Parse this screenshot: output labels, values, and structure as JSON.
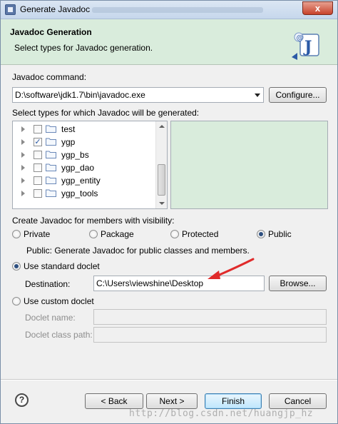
{
  "window": {
    "title": "Generate Javadoc",
    "close_label": "x"
  },
  "header": {
    "title": "Javadoc Generation",
    "description": "Select types for Javadoc generation."
  },
  "command": {
    "label": "Javadoc command:",
    "value": "D:\\software\\jdk1.7\\bin\\javadoc.exe",
    "configure_label": "Configure..."
  },
  "types": {
    "label": "Select types for which Javadoc will be generated:",
    "items": [
      {
        "label": "test",
        "checked": false
      },
      {
        "label": "ygp",
        "checked": true
      },
      {
        "label": "ygp_bs",
        "checked": false
      },
      {
        "label": "ygp_dao",
        "checked": false
      },
      {
        "label": "ygp_entity",
        "checked": false
      },
      {
        "label": "ygp_tools",
        "checked": false
      }
    ]
  },
  "visibility": {
    "label": "Create Javadoc for members with visibility:",
    "options": [
      "Private",
      "Package",
      "Protected",
      "Public"
    ],
    "selected": "Public",
    "description": "Public: Generate Javadoc for public classes and members."
  },
  "standard_doclet": {
    "label": "Use standard doclet",
    "selected": true,
    "destination_label": "Destination:",
    "destination_value": "C:\\Users\\viewshine\\Desktop",
    "browse_label": "Browse..."
  },
  "custom_doclet": {
    "label": "Use custom doclet",
    "selected": false,
    "name_label": "Doclet name:",
    "class_path_label": "Doclet class path:"
  },
  "footer": {
    "help_label": "?",
    "back_label": "< Back",
    "next_label": "Next >",
    "finish_label": "Finish",
    "cancel_label": "Cancel"
  },
  "watermark": "http://blog.csdn.net/huangjp_hz",
  "colors": {
    "header_bg": "#d9ecdc",
    "accent_arrow": "#e02b2b",
    "default_button": "#3c7fb1"
  }
}
